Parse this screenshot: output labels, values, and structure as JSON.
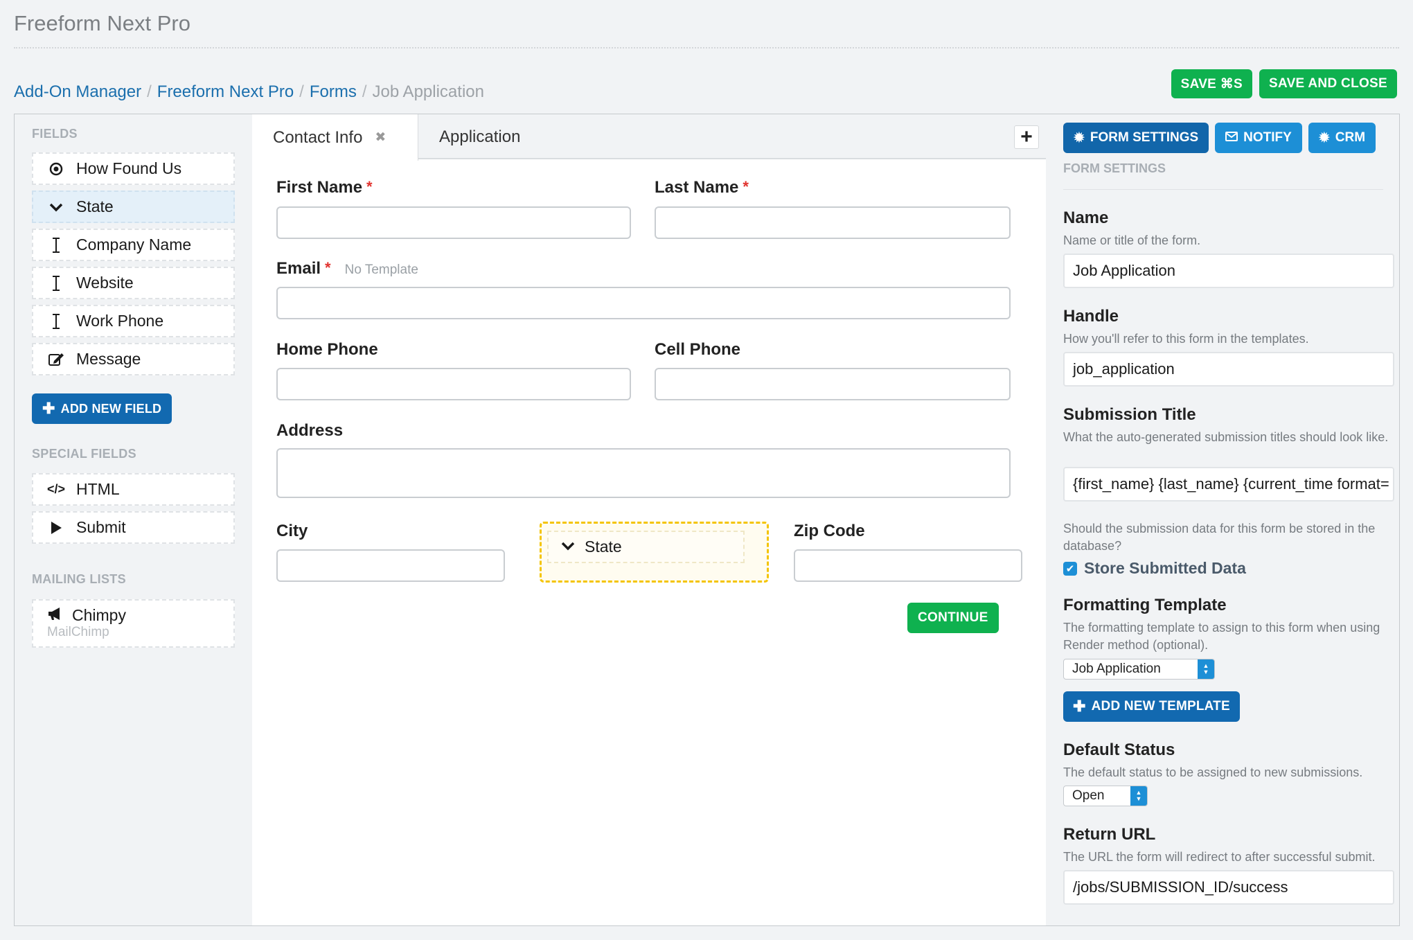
{
  "app_title": "Freeform Next Pro",
  "breadcrumb": {
    "items": [
      "Add-On Manager",
      "Freeform Next Pro",
      "Forms"
    ],
    "current": "Job Application",
    "separator": "/"
  },
  "actions": {
    "save_label": "SAVE ⌘S",
    "save_close_label": "SAVE AND CLOSE"
  },
  "left": {
    "fields_title": "FIELDS",
    "fields": [
      {
        "label": "How Found Us",
        "icon": "radio-icon"
      },
      {
        "label": "State",
        "icon": "chevron-down-icon"
      },
      {
        "label": "Company Name",
        "icon": "text-cursor-icon"
      },
      {
        "label": "Website",
        "icon": "text-cursor-icon"
      },
      {
        "label": "Work Phone",
        "icon": "text-cursor-icon"
      },
      {
        "label": "Message",
        "icon": "edit-icon"
      }
    ],
    "add_field_label": "ADD NEW FIELD",
    "special_title": "SPECIAL FIELDS",
    "special_fields": [
      {
        "label": "HTML",
        "icon": "code-icon"
      },
      {
        "label": "Submit",
        "icon": "play-icon"
      }
    ],
    "mailing_title": "MAILING LISTS",
    "mailing": {
      "label": "Chimpy",
      "sub": "MailChimp",
      "icon": "megaphone-icon"
    }
  },
  "center": {
    "tabs": [
      {
        "label": "Contact Info"
      },
      {
        "label": "Application"
      }
    ],
    "fields": {
      "first_name": "First Name",
      "last_name": "Last Name",
      "email": "Email",
      "email_note": "No Template",
      "home_phone": "Home Phone",
      "cell_phone": "Cell Phone",
      "address": "Address",
      "city": "City",
      "state": "State",
      "zip": "Zip Code"
    },
    "required_mark": "*",
    "continue_label": "CONTINUE"
  },
  "right": {
    "tabs": [
      {
        "label": "FORM SETTINGS",
        "icon": "gear-icon"
      },
      {
        "label": "NOTIFY",
        "icon": "envelope-icon"
      },
      {
        "label": "CRM",
        "icon": "gear-icon"
      }
    ],
    "section_title": "FORM SETTINGS",
    "name_label": "Name",
    "name_help": "Name or title of the form.",
    "name_value": "Job Application",
    "handle_label": "Handle",
    "handle_help": "How you'll refer to this form in the templates.",
    "handle_value": "job_application",
    "submission_label": "Submission Title",
    "submission_help": "What the auto-generated submission titles should look like.",
    "submission_value": "{first_name} {last_name} {current_time format=",
    "store_help": "Should the submission data for this form be stored in the database?",
    "store_label": "Store Submitted Data",
    "formatting_label": "Formatting Template",
    "formatting_help": "The formatting template to assign to this form when using Render method (optional).",
    "formatting_value": "Job Application",
    "add_template_label": "ADD NEW TEMPLATE",
    "status_label": "Default Status",
    "status_help": "The default status to be assigned to new submissions.",
    "status_value": "Open",
    "return_label": "Return URL",
    "return_help": "The URL the form will redirect to after successful submit.",
    "return_value": "/jobs/SUBMISSION_ID/success"
  }
}
